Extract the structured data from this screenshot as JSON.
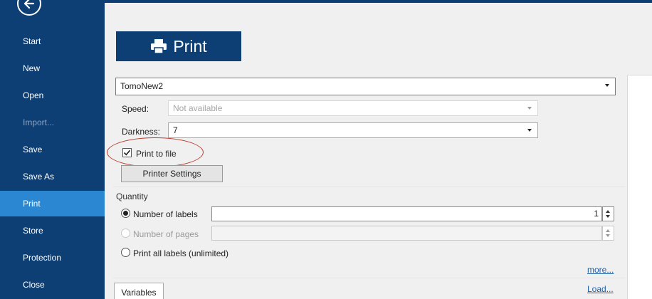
{
  "sidebar": {
    "items": [
      {
        "label": "Start"
      },
      {
        "label": "New"
      },
      {
        "label": "Open"
      },
      {
        "label": "Import..."
      },
      {
        "label": "Save"
      },
      {
        "label": "Save As"
      },
      {
        "label": "Print"
      },
      {
        "label": "Store"
      },
      {
        "label": "Protection"
      },
      {
        "label": "Close"
      }
    ],
    "active": "Print",
    "disabled": [
      "Import..."
    ]
  },
  "header": {
    "print_label": "Print"
  },
  "printer": {
    "selected": "TomoNew2"
  },
  "settings": {
    "speed_label": "Speed:",
    "speed_value": "Not available",
    "darkness_label": "Darkness:",
    "darkness_value": "7",
    "print_to_file_label": "Print to file",
    "print_to_file_checked": true,
    "printer_settings_label": "Printer Settings"
  },
  "quantity": {
    "title": "Quantity",
    "number_of_labels_label": "Number of labels",
    "number_of_labels_value": "1",
    "number_of_pages_label": "Number of pages",
    "number_of_pages_value": "",
    "print_all_label": "Print all labels (unlimited)",
    "selected_option": "Number of labels"
  },
  "links": {
    "more": "more...",
    "load": "Load..."
  },
  "tabs": {
    "variables": "Variables"
  },
  "colors": {
    "sidebar_bg": "#0e3f74",
    "active_item": "#2b87d1",
    "annotation": "#c0392b"
  }
}
